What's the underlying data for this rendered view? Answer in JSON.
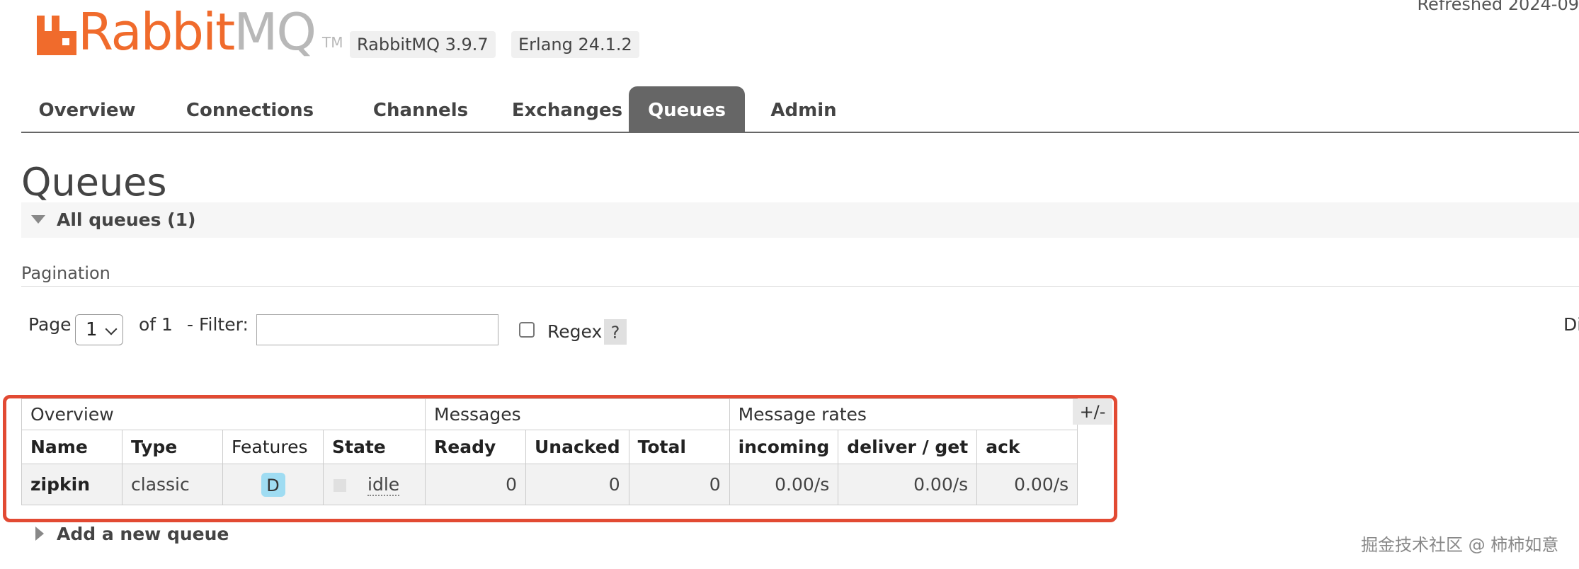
{
  "header": {
    "logo_rabbit": "Rabbit",
    "logo_mq": "MQ",
    "logo_tm": "TM",
    "rabbitmq_version": "RabbitMQ 3.9.7",
    "erlang_version": "Erlang 24.1.2",
    "refreshed": "Refreshed 2024-09"
  },
  "tabs": [
    {
      "label": "Overview",
      "active": false
    },
    {
      "label": "Connections",
      "active": false
    },
    {
      "label": "Channels",
      "active": false
    },
    {
      "label": "Exchanges",
      "active": false
    },
    {
      "label": "Queues",
      "active": true
    },
    {
      "label": "Admin",
      "active": false
    }
  ],
  "page_title": "Queues",
  "all_queues_section": {
    "label": "All queues (1)",
    "expanded": true
  },
  "pagination": {
    "heading": "Pagination",
    "page_label": "Page",
    "page_value": "1",
    "of_label": "of 1",
    "filter_label": "- Filter:",
    "filter_value": "",
    "regex_label": "Regex",
    "regex_checked": false,
    "help_label": "?",
    "display_label": "Di"
  },
  "table": {
    "group_headers": [
      "Overview",
      "Messages",
      "Message rates"
    ],
    "toggle_columns": "+/-",
    "columns": [
      "Name",
      "Type",
      "Features",
      "State",
      "Ready",
      "Unacked",
      "Total",
      "incoming",
      "deliver / get",
      "ack"
    ],
    "rows": [
      {
        "name": "zipkin",
        "type": "classic",
        "features": "D",
        "state": "idle",
        "ready": "0",
        "unacked": "0",
        "total": "0",
        "incoming": "0.00/s",
        "deliver_get": "0.00/s",
        "ack": "0.00/s"
      }
    ]
  },
  "add_queue": {
    "label": "Add a new queue",
    "expanded": false
  },
  "watermark": "掘金技术社区 @ 柿柿如意",
  "colors": {
    "brand_orange": "#f06b2c",
    "logo_grey": "#b8b8b8",
    "active_tab": "#666666",
    "highlight_frame": "#e24a33",
    "feature_badge": "#9fdcf2"
  }
}
